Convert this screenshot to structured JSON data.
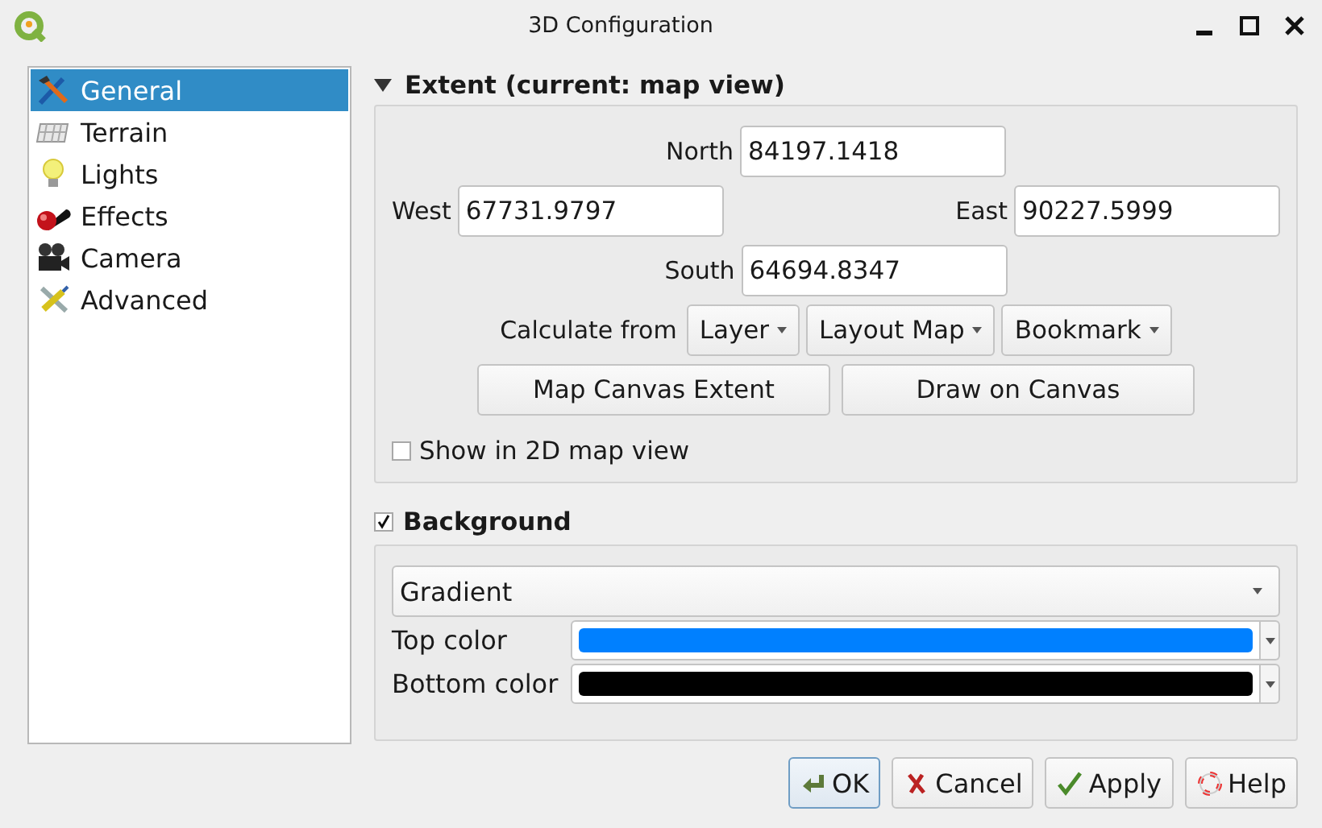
{
  "window": {
    "title": "3D Configuration"
  },
  "sidebar": {
    "items": [
      {
        "label": "General",
        "selected": true
      },
      {
        "label": "Terrain",
        "selected": false
      },
      {
        "label": "Lights",
        "selected": false
      },
      {
        "label": "Effects",
        "selected": false
      },
      {
        "label": "Camera",
        "selected": false
      },
      {
        "label": "Advanced",
        "selected": false
      }
    ]
  },
  "extent": {
    "title": "Extent (current: map view)",
    "expanded": true,
    "north": {
      "label": "North",
      "value": "84197.1418"
    },
    "west": {
      "label": "West",
      "value": "67731.9797"
    },
    "east": {
      "label": "East",
      "value": "90227.5999"
    },
    "south": {
      "label": "South",
      "value": "64694.8347"
    },
    "calculate_label": "Calculate from",
    "calculate_buttons": [
      "Layer",
      "Layout Map",
      "Bookmark"
    ],
    "buttons": [
      "Map Canvas Extent",
      "Draw on Canvas"
    ],
    "show_in_2d": {
      "label": "Show in 2D map view",
      "checked": false
    }
  },
  "background": {
    "title": "Background",
    "checked": true,
    "type": {
      "value": "Gradient"
    },
    "colors": [
      {
        "label": "Top color",
        "color": "#0080ff"
      },
      {
        "label": "Bottom color",
        "color": "#000000"
      }
    ]
  },
  "buttons": [
    {
      "label": "OK",
      "default": true
    },
    {
      "label": "Cancel",
      "default": false
    },
    {
      "label": "Apply",
      "default": false
    },
    {
      "label": "Help",
      "default": false
    }
  ]
}
